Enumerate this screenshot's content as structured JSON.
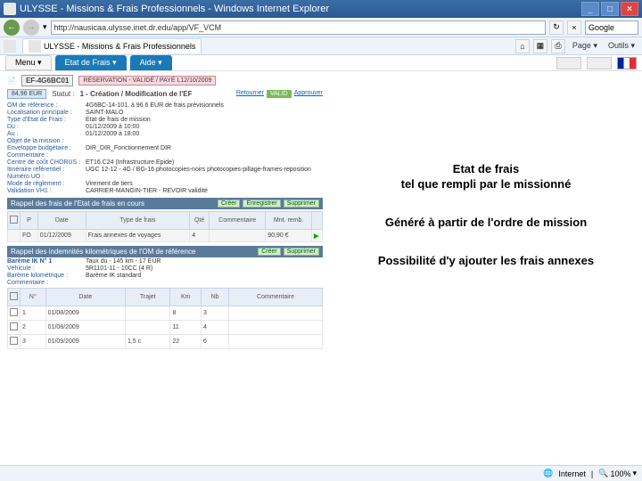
{
  "window": {
    "title": "ULYSSE - Missions & Frais Professionnels - Windows Internet Explorer",
    "min": "_",
    "max": "□",
    "close": "×"
  },
  "ie": {
    "back": "←",
    "fwd": "→",
    "address": "http://nausicaa.ulysse.inet.dr.edu/app/VF_VCM",
    "refresh": "↻",
    "stop": "×",
    "search": "Google",
    "tab": "ULYSSE - Missions & Frais Professionnels",
    "tools": {
      "page": "Page ▾",
      "outils": "Outils ▾"
    },
    "sep": "▾"
  },
  "menu": {
    "t1": "Menu ▾",
    "t2": "Etat de Frais ▾",
    "t3": "Aide ▾"
  },
  "ef": {
    "id": "EF-4G6BC01",
    "pink": "RÉSERVATION - VALIDÉ / PAYÉ L12/10/2009",
    "amount": "84,96 EUR",
    "statut_label": "Statut :",
    "statut": "1 - Création / Modification de l'EF",
    "act_retourner": "Retourner",
    "act_valid": "VALID",
    "act_approuver": "Approuver"
  },
  "kv": {
    "om_ref_k": "OM de référence :",
    "om_ref_v": "4G6BC-14-101. à 96.6 EUR de frais prévisionnels",
    "loc_k": "Localisation principale :",
    "loc_v": "SAINT-MALO",
    "type_k": "Type d'Etat de Frais :",
    "type_v": "Etat de frais de mission",
    "du_k": "Du :",
    "du_v": "01/12/2009   à   10:00",
    "au_k": "Au :",
    "au_v": "01/12/2009   à   18:00",
    "obj_k": "Objet de la mission :",
    "env_k": "Enveloppe budgétaire :",
    "env_v": "DIR_DIR_Fonctionnement DIR",
    "com_k": "Commentaire :",
    "cc_k": "Centre de coût CHORUS :",
    "cc_v": "ET16.C24 (Infrastructure.Epide)",
    "itin_k": "Itinéraire référentiel :",
    "itin_v": "UGC 12-12 - 4G / BG-16 photocopies-noirs photocopies-pillage-frames-reposition",
    "num_k": "Numéro UO :",
    "mode_k": "Mode de règlement :",
    "mode_v": "Virement de tiers",
    "val_k": "Validation VH1 :",
    "val_v": "CARRIER-MANGIN-TIER - REVOIR validité"
  },
  "sec1": {
    "title": "Rappel des frais de l'Etat de frais en cours",
    "b1": "Créer",
    "b2": "Enregistrer",
    "b3": "Supprimer",
    "cols": {
      "p": "P",
      "date": "Date",
      "type": "Type de frais",
      "qte": "Qté",
      "com": "Commentaire",
      "mnt": "Mnt. remb."
    },
    "row": {
      "p": "FO",
      "date": "01/12/2009",
      "type": "Frais annexes de voyages",
      "qte": "4",
      "mnt": "90,90 €",
      "arrow": "▶"
    }
  },
  "sec2": {
    "title": "Rappel des indemnités kilométriques de l'OM de référence",
    "b1": "Créer",
    "b2": "Supprimer",
    "bareme_k": "Barème IK N° 1",
    "bareme_v": "Taux du - 145 km - 17 EUR",
    "veh_k": "Véhicule :",
    "veh_v": "5R1101-11 - 10CC (4 R)",
    "bar_k": "Barème kilométrique :",
    "bar_v": "Barème IK standard",
    "com2_k": "Commentaire :",
    "cols": {
      "n": "N°",
      "date": "Date",
      "trajet": "Trajet",
      "km": "Km",
      "nb": "Nb",
      "com": "Commentaire"
    },
    "r1": {
      "n": "1",
      "date": "01/08/2009",
      "trajet": "",
      "km": "8",
      "nb": "3"
    },
    "r2": {
      "n": "2",
      "date": "01/08/2009",
      "trajet": "",
      "km": "11",
      "nb": "4"
    },
    "r3": {
      "n": "3",
      "date": "01/09/2009",
      "trajet": "1,5 c",
      "km": "22",
      "nb": "6"
    }
  },
  "annot": {
    "a1": "Etat de frais\ntel que rempli par le missionné",
    "a2": "Généré à partir de l'ordre de mission",
    "a3": "Possibilité d'y ajouter les frais annexes"
  },
  "status": {
    "internet": "Internet",
    "zoom": "100%"
  }
}
